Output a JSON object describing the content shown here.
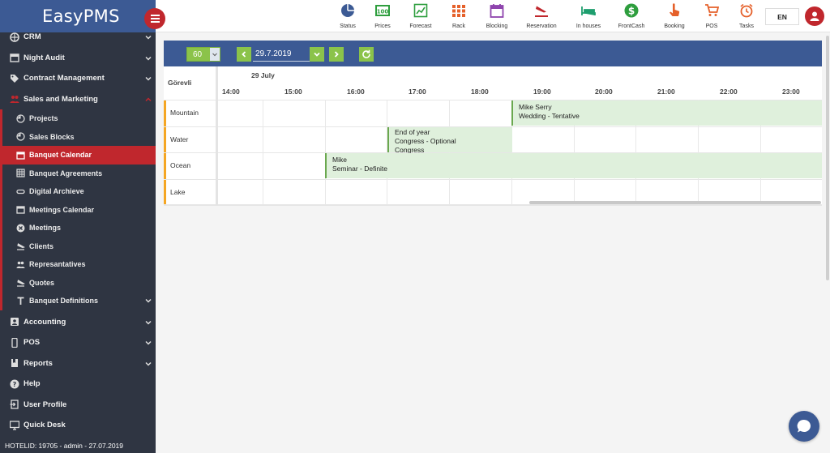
{
  "app": {
    "brand": "EasyPMS"
  },
  "sidebar": {
    "items": [
      {
        "label": "CRM",
        "icon": "crm-icon"
      },
      {
        "label": "Night Audit",
        "icon": "calendar-icon"
      },
      {
        "label": "Contract Management",
        "icon": "tag-icon"
      },
      {
        "label": "Sales and Marketing",
        "icon": "people-icon"
      }
    ],
    "sub_items": [
      {
        "label": "Projects",
        "icon": "clock-icon"
      },
      {
        "label": "Sales Blocks",
        "icon": "clock-icon"
      },
      {
        "label": "Banquet Calendar",
        "icon": "calendar-icon"
      },
      {
        "label": "Banquet Agreements",
        "icon": "grid-icon"
      },
      {
        "label": "Digital Archieve",
        "icon": "archive-icon"
      },
      {
        "label": "Meetings Calendar",
        "icon": "calendar-icon"
      },
      {
        "label": "Meetings",
        "icon": "cancel-circle-icon"
      },
      {
        "label": "Clients",
        "icon": "plane-icon"
      },
      {
        "label": "Represantatives",
        "icon": "people-icon"
      },
      {
        "label": "Quotes",
        "icon": "plane-icon"
      },
      {
        "label": "Banquet Definitions",
        "icon": "text-icon"
      }
    ],
    "bottom_items": [
      {
        "label": "Accounting",
        "icon": "person-box-icon"
      },
      {
        "label": "POS",
        "icon": "mobile-icon"
      },
      {
        "label": "Reports",
        "icon": "book-icon"
      },
      {
        "label": "Help",
        "icon": "help-icon"
      },
      {
        "label": "User Profile",
        "icon": "user-profile-icon"
      },
      {
        "label": "Quick Desk",
        "icon": "monitor-icon"
      }
    ],
    "footer": "HOTELID: 19705 - admin - 27.07.2019"
  },
  "topbar": {
    "items": [
      {
        "label": "Status",
        "icon": "pie-chart-icon",
        "color": "#3c5a94"
      },
      {
        "label": "Prices",
        "icon": "prices-icon",
        "color": "#2e9e3e"
      },
      {
        "label": "Forecast",
        "icon": "forecast-icon",
        "color": "#2e9e3e"
      },
      {
        "label": "Rack",
        "icon": "rack-grid-icon",
        "color": "#e5602a"
      },
      {
        "label": "Blocking",
        "icon": "calendar-icon",
        "color": "#8e44ad"
      },
      {
        "label": "Reservation",
        "icon": "plane-icon",
        "color": "#c0272d"
      },
      {
        "label": "In houses",
        "icon": "bed-icon",
        "color": "#1e9e6e"
      },
      {
        "label": "FrontCash",
        "icon": "dollar-icon",
        "color": "#2e9e3e"
      },
      {
        "label": "Booking",
        "icon": "hand-icon",
        "color": "#e5602a"
      },
      {
        "label": "POS",
        "icon": "cart-icon",
        "color": "#e5602a"
      },
      {
        "label": "Tasks",
        "icon": "alarm-icon",
        "color": "#e5602a"
      }
    ],
    "language": "EN"
  },
  "toolbar": {
    "duration": "60",
    "date": "29.7.2019"
  },
  "schedule": {
    "column_header": "Görevli",
    "day": "29 July",
    "hours": [
      "14:00",
      "15:00",
      "16:00",
      "17:00",
      "18:00",
      "19:00",
      "20:00",
      "21:00",
      "22:00",
      "23:00"
    ],
    "rooms": [
      "Mountain",
      "Water",
      "Ocean",
      "Lake"
    ],
    "events": [
      {
        "line1": "Mike Serry",
        "line2": "Wedding - Tentative",
        "line3": ""
      },
      {
        "line1": "End of year",
        "line2": "Congress - Optional",
        "line3": "Congress"
      },
      {
        "line1": "Mike",
        "line2": "Seminar - Definite",
        "line3": ""
      }
    ]
  },
  "colors": {
    "accent": "#3c5a94",
    "active": "#c0272d",
    "green": "#8bc34a",
    "event": "#dff0dc"
  }
}
